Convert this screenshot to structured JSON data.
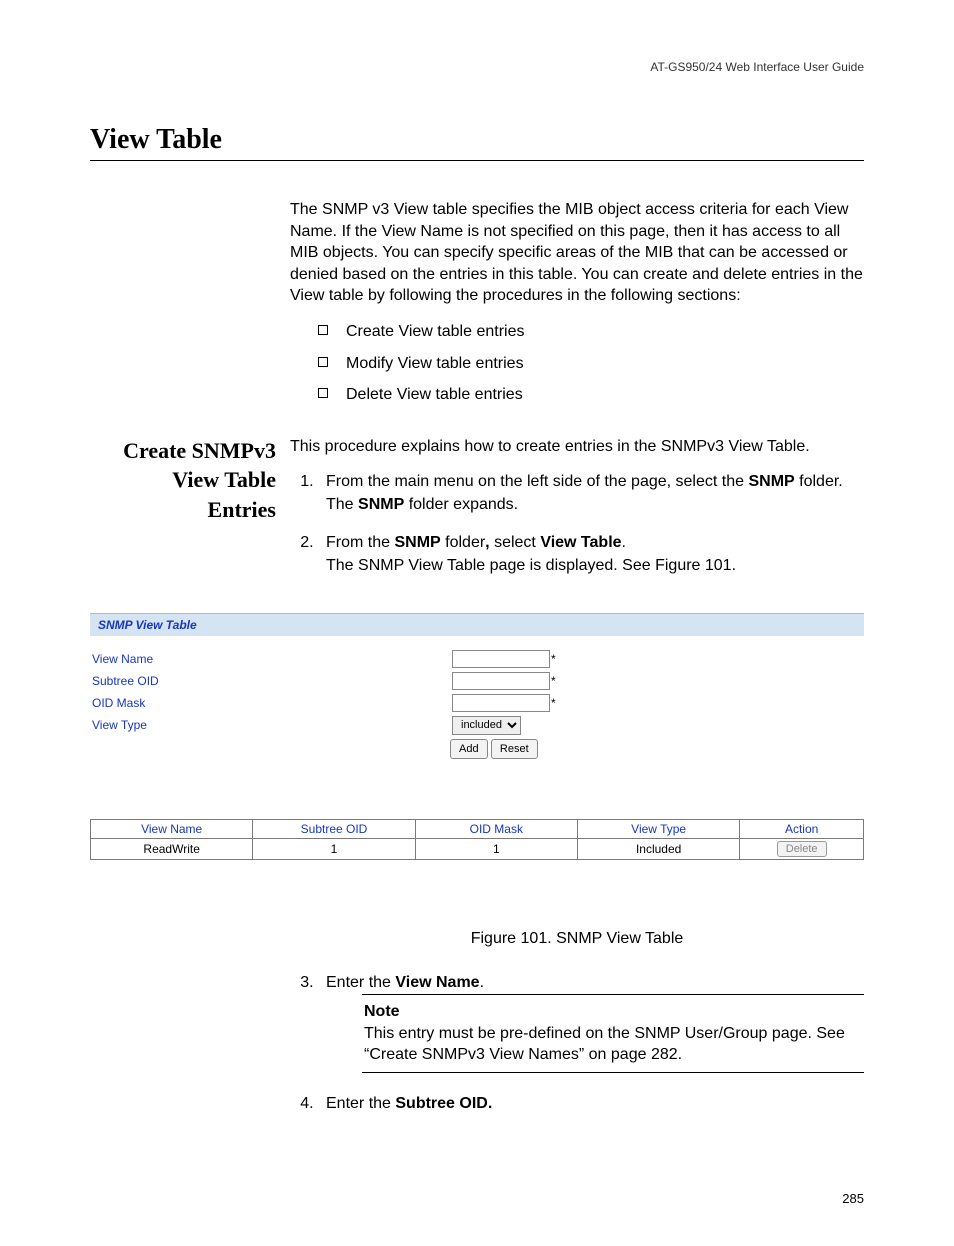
{
  "header": {
    "guide": "AT-GS950/24  Web Interface User Guide"
  },
  "title": "View Table",
  "intro": "The SNMP v3 View table specifies the MIB object access criteria for each View Name. If the View Name is not specified on this page, then it has access to all MIB objects. You can specify specific areas of the MIB that can be accessed or denied based on the entries in this table. You can create and delete entries in the View table by following the procedures in the following sections:",
  "bullets": [
    "Create View table entries",
    "Modify View table entries",
    "Delete View table entries"
  ],
  "section2": {
    "heading_l1": "Create SNMPv3",
    "heading_l2": "View Table",
    "heading_l3": "Entries",
    "intro": "This procedure explains how to create entries in the SNMPv3 View Table.",
    "step1_a": "From the main menu on the left side of the page, select the ",
    "step1_bold": "SNMP",
    "step1_b": " folder.",
    "step1_c1": "The ",
    "step1_c_bold": "SNMP",
    "step1_c2": " folder expands.",
    "step2_a": "From the ",
    "step2_bold1": "SNMP",
    "step2_b": " folder",
    "step2_comma": ",",
    "step2_c": " select ",
    "step2_bold2": "View Table",
    "step2_d": ".",
    "step2_e": "The SNMP View Table page is displayed. See Figure 101."
  },
  "snmp": {
    "title": "SNMP View Table",
    "labels": {
      "view_name": "View Name",
      "subtree_oid": "Subtree OID",
      "oid_mask": "OID Mask",
      "view_type": "View Type"
    },
    "select_value": "included",
    "add": "Add",
    "reset": "Reset",
    "table": {
      "headers": [
        "View Name",
        "Subtree OID",
        "OID Mask",
        "View Type",
        "Action"
      ],
      "row": {
        "c0": "ReadWrite",
        "c1": "1",
        "c2": "1",
        "c3": "Included",
        "action": "Delete"
      }
    }
  },
  "figure_caption": "Figure 101. SNMP View Table",
  "step3_a": "Enter the ",
  "step3_bold": "View Name",
  "step3_b": ".",
  "note": {
    "title": "Note",
    "body": "This entry must be pre-defined on the SNMP User/Group page. See “Create SNMPv3 View Names” on page 282."
  },
  "step4_a": "Enter the ",
  "step4_bold": "Subtree OID.",
  "page_num": "285"
}
